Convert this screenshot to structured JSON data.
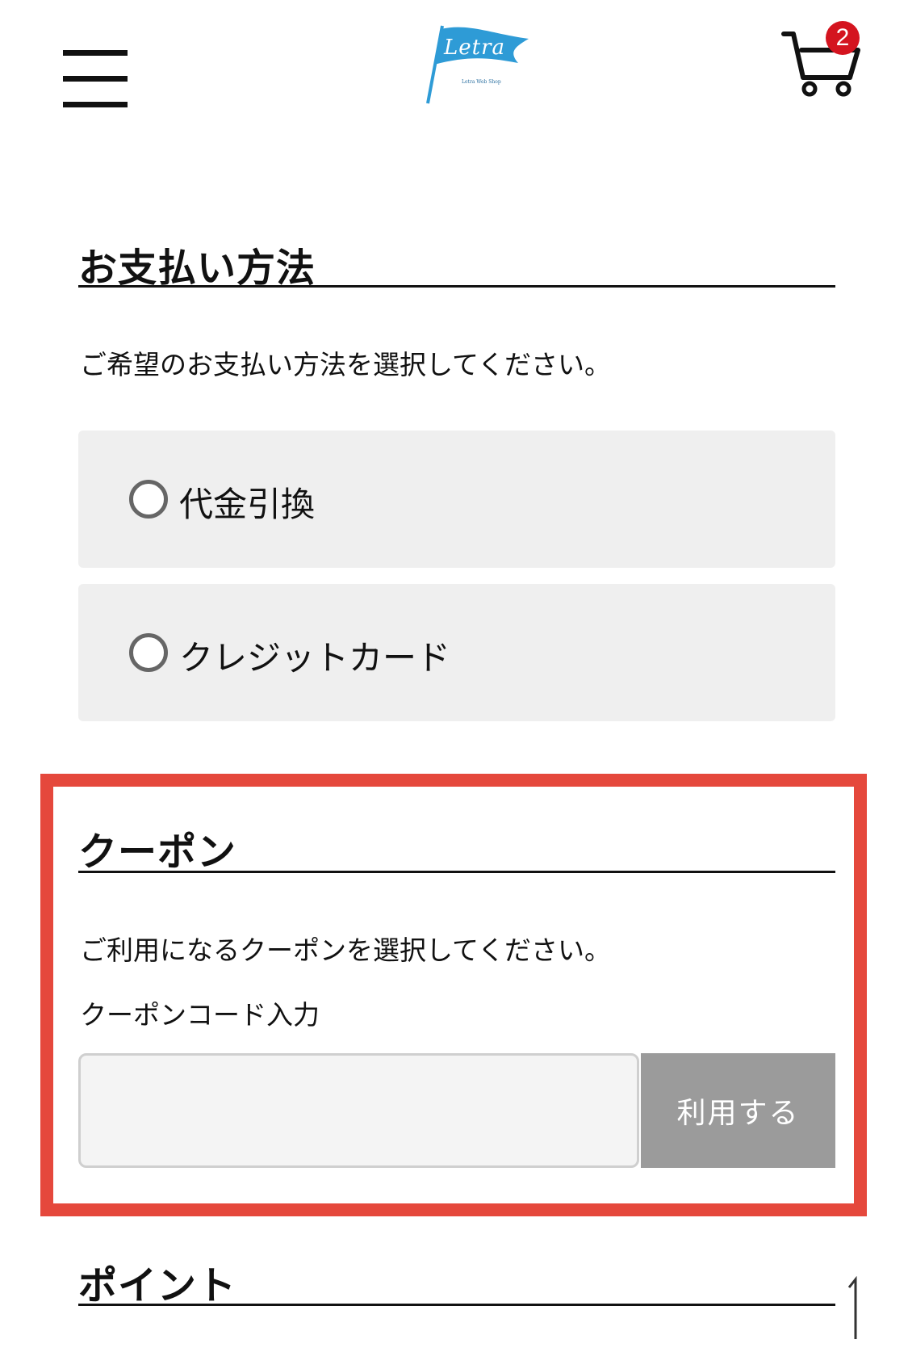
{
  "header": {
    "logo": {
      "text": "Letra",
      "subtext": "Letra Web Shop",
      "color": "#2e9bd6"
    },
    "cart": {
      "count": "2",
      "badge_color": "#d4141f"
    }
  },
  "payment": {
    "title": "お支払い方法",
    "description": "ご希望のお支払い方法を選択してください。",
    "options": [
      {
        "label": "代金引換",
        "selected": false
      },
      {
        "label": "クレジットカード",
        "selected": false
      }
    ]
  },
  "coupon": {
    "title": "クーポン",
    "description": "ご利用になるクーポンを選択してください。",
    "input_label": "クーポンコード入力",
    "input_value": "",
    "apply_label": "利用する",
    "highlight_color": "#e5483c"
  },
  "point": {
    "title": "ポイント"
  }
}
